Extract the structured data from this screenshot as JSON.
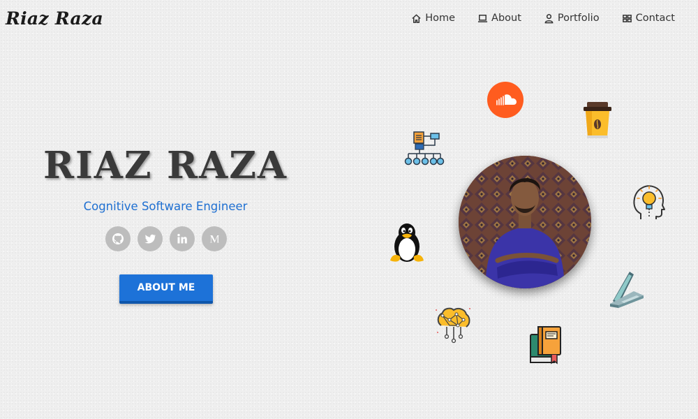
{
  "brand": {
    "logo": "Riaz Raza"
  },
  "nav": [
    {
      "label": "Home",
      "icon": "home-icon"
    },
    {
      "label": "About",
      "icon": "laptop-icon"
    },
    {
      "label": "Portfolio",
      "icon": "user-icon"
    },
    {
      "label": "Contact",
      "icon": "grid-icon"
    }
  ],
  "hero": {
    "name": "RIAZ RAZA",
    "subtitle": "Cognitive Software Engineer",
    "about_button": "ABOUT ME",
    "socials": [
      "github-icon",
      "twitter-icon",
      "linkedin-icon",
      "medium-icon"
    ]
  },
  "colors": {
    "accent": "#1d72d8",
    "subtitle": "#1e6fd1",
    "social_bg": "#bdbdbd",
    "soundcloud": "#ff5c1f"
  },
  "floating_icons": [
    "soundcloud-icon",
    "coffee-cup-icon",
    "flowchart-icon",
    "idea-head-icon",
    "linux-penguin-icon",
    "laptop-icon",
    "brain-network-icon",
    "books-icon"
  ]
}
